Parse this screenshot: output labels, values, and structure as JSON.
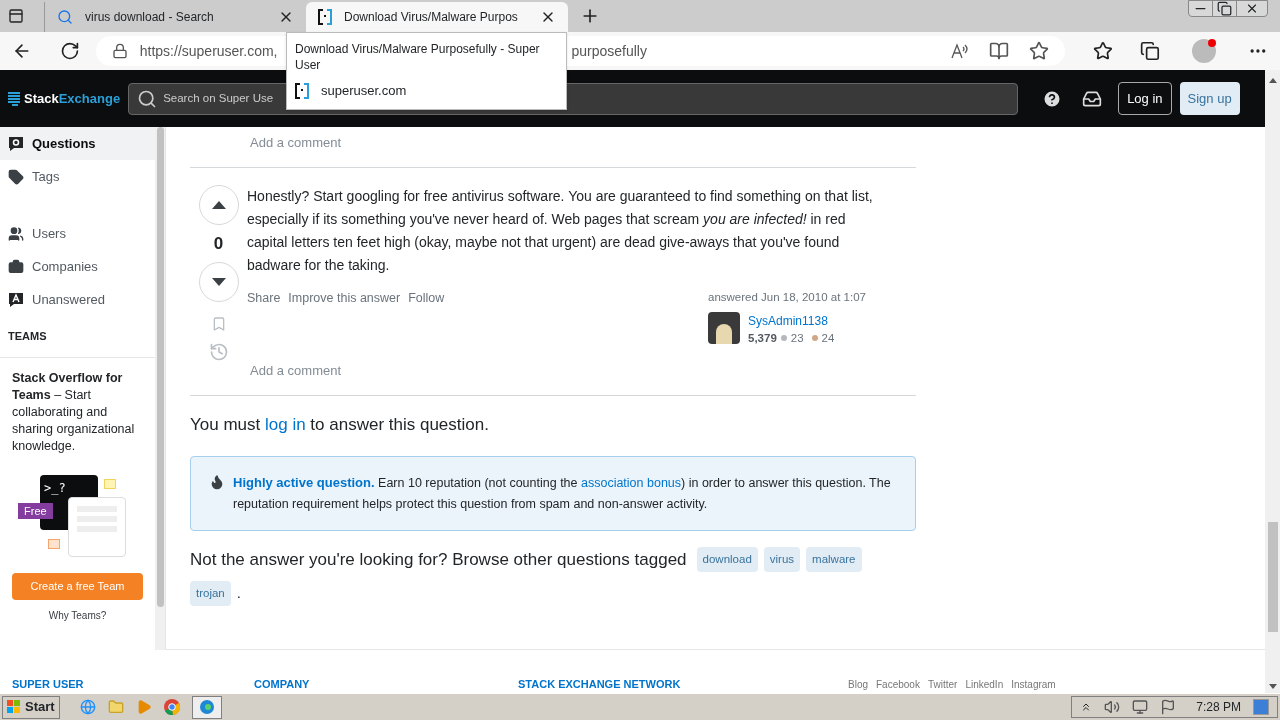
{
  "browser": {
    "tabs": [
      {
        "title": "virus download - Search",
        "selected": false,
        "kind": "search"
      },
      {
        "title": "Download Virus/Malware Purpos",
        "selected": true,
        "kind": "site"
      }
    ],
    "address": {
      "url_start": "https://superuser.com,",
      "url_end": "purposefully"
    },
    "tooltip": {
      "title": "Download Virus/Malware Purposefully - Super User",
      "domain": "superuser.com"
    }
  },
  "header": {
    "logo_left": "Stack",
    "logo_right": "Exchange",
    "search_placeholder": "Search on Super Use",
    "login": "Log in",
    "signup": "Sign up"
  },
  "sidebar": {
    "items": [
      {
        "label": "Questions",
        "selected": true,
        "kind": "questions"
      },
      {
        "label": "Tags",
        "selected": false,
        "kind": "tags"
      },
      {
        "label": "Users",
        "selected": false,
        "kind": "users"
      },
      {
        "label": "Companies",
        "selected": false,
        "kind": "companies"
      },
      {
        "label": "Unanswered",
        "selected": false,
        "kind": "unanswered"
      }
    ],
    "teams_heading": "TEAMS",
    "teams_text": "**Stack Overflow for Teams** – Start collaborating and sharing organizational knowledge.",
    "terminal": ">_?",
    "free_badge": "Free",
    "cta": "Create a free Team",
    "why": "Why Teams?"
  },
  "answer": {
    "previous_comment": "Add a comment",
    "votes": "0",
    "body": "Honestly? Start googling for free antivirus software. You are guaranteed to find something on that list, especially if its something you've never heard of. Web pages that scream *you are infected!* in red capital letters ten feet high (okay, maybe not that urgent) are dead give-aways that you've found badware for the taking.",
    "actions": [
      "Share",
      "Improve this answer",
      "Follow"
    ],
    "answered": "answered Jun 18, 2010 at 1:07",
    "user": "SysAdmin1138",
    "reputation": "5,379",
    "silver": "23",
    "bronze": "24",
    "add_comment": "Add a comment"
  },
  "login_prompt": {
    "before": "You must ",
    "link": "log in",
    "after": " to answer this question."
  },
  "notice": {
    "title": "Highly active question.",
    "before": " Earn 10 reputation (not counting the ",
    "link": "association bonus",
    "after": ") in order to answer this question. The reputation requirement helps protect this question from spam and non-answer activity."
  },
  "tagged": {
    "text": "Not the answer you're looking for? Browse other questions tagged",
    "tags": [
      "download",
      "virus",
      "malware",
      "trojan"
    ],
    "end": "."
  },
  "footer": {
    "headings": [
      "SUPER USER",
      "COMPANY",
      "STACK EXCHANGE NETWORK"
    ],
    "links": [
      "Blog",
      "Facebook",
      "Twitter",
      "LinkedIn",
      "Instagram"
    ]
  },
  "taskbar": {
    "start": "Start",
    "clock": "7:28 PM"
  }
}
